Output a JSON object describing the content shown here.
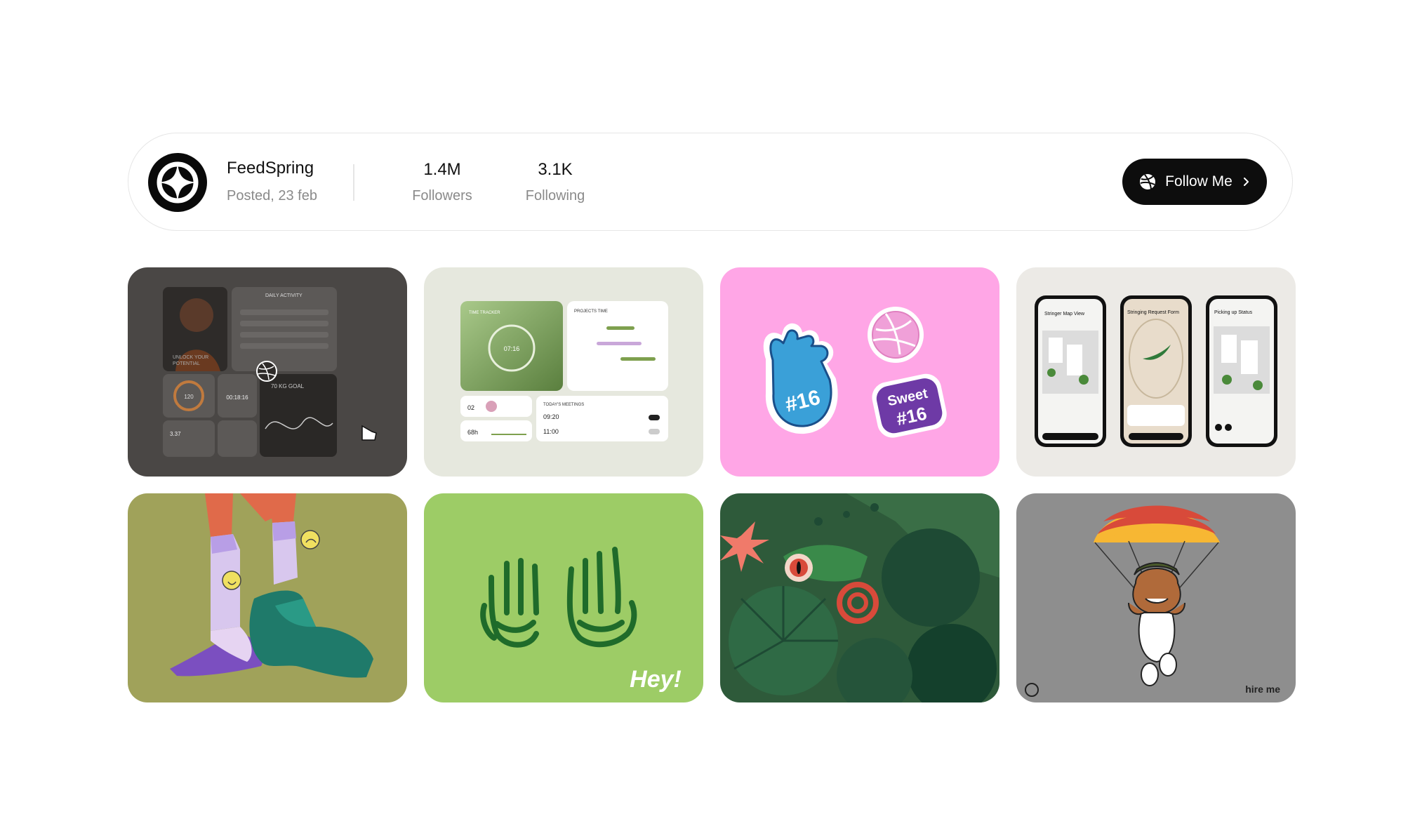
{
  "profile": {
    "name": "FeedSpring",
    "posted": "Posted, 23 feb",
    "avatar_icon": "four-point-star-logo",
    "stats": [
      {
        "value": "1.4M",
        "label": "Followers"
      },
      {
        "value": "3.1K",
        "label": "Following"
      }
    ],
    "follow_button": {
      "label": "Follow Me",
      "icon": "dribbble-icon",
      "trailing_icon": "chevron-right-icon"
    }
  },
  "shots": {
    "fitness": {
      "subject": "fitness-dashboard",
      "texts": {
        "daily_activity": "DAILY ACTIVITY",
        "unlock": "UNLOCK YOUR",
        "potential": "POTENTIAL",
        "gauge": "120",
        "timer": "00:18:16",
        "goal": "70 KG GOAL",
        "weight": "3.37"
      }
    },
    "time_tracker": {
      "subject": "time-tracker-dashboard",
      "texts": {
        "tracker_title": "TIME TRACKER",
        "ring_time": "07:16",
        "projects": "PROJECTS TIME",
        "meetings": "TODAY'S MEETINGS",
        "count": "02",
        "hours": "68h",
        "m1": "09:20",
        "m2": "11:00"
      }
    },
    "stickers": {
      "subject": "dribbble-stickers",
      "texts": {
        "foam_hand": "#16",
        "sweet": "Sweet",
        "sweet_num": "#16"
      }
    },
    "mobile_app": {
      "subject": "three-phone-mockups",
      "texts": {
        "p1_title": "Stringer Map View",
        "p2_title": "Stringing Request Form",
        "p3_title": "Picking up Status"
      }
    },
    "socks": {
      "subject": "socks-and-shoes-illustration"
    },
    "hey": {
      "subject": "waving-hands-logo",
      "texts": {
        "wordmark": "Hey!"
      }
    },
    "chameleon": {
      "subject": "chameleon-jungle-illustration"
    },
    "parachute": {
      "subject": "parachuting-bulldog",
      "texts": {
        "hire_me": "hire me"
      }
    }
  },
  "colors": {
    "accent_dark": "#0d0d0d",
    "muted_text": "#8a8a8a",
    "pink": "#ffa6e6",
    "lime": "#9dcc66",
    "olive": "#a0a25a",
    "gray": "#8e8e8e"
  }
}
